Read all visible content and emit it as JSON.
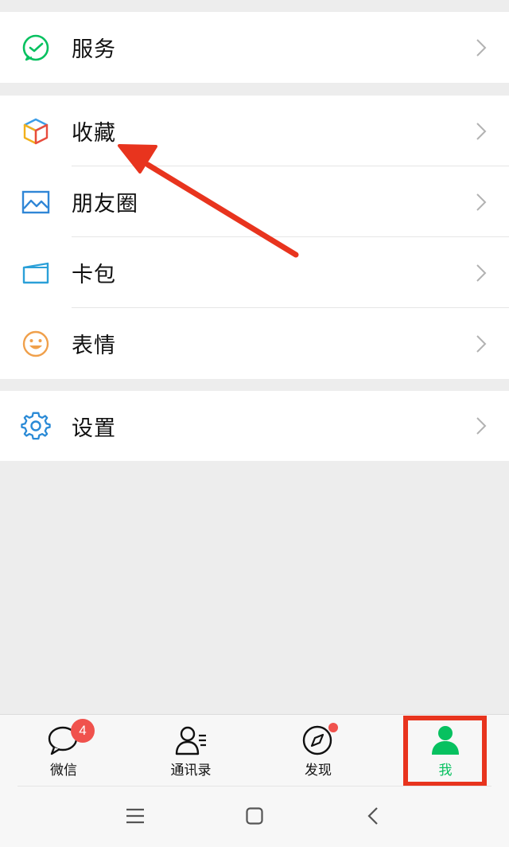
{
  "menu": {
    "services": {
      "label": "服务",
      "icon": "services-icon"
    },
    "favorites": {
      "label": "收藏",
      "icon": "favorites-cube-icon"
    },
    "moments": {
      "label": "朋友圈",
      "icon": "moments-picture-icon"
    },
    "cards": {
      "label": "卡包",
      "icon": "card-wallet-icon"
    },
    "stickers": {
      "label": "表情",
      "icon": "smiley-icon"
    },
    "settings": {
      "label": "设置",
      "icon": "gear-icon"
    }
  },
  "tabbar": {
    "chats": {
      "label": "微信",
      "badge": "4"
    },
    "contacts": {
      "label": "通讯录"
    },
    "discover": {
      "label": "发现"
    },
    "me": {
      "label": "我"
    }
  },
  "colors": {
    "accent_green": "#07c160",
    "annotation_red": "#e8341e",
    "badge_red": "#f0524d"
  },
  "annotations": {
    "arrow_target": "favorites",
    "highlight_target": "me-tab"
  }
}
